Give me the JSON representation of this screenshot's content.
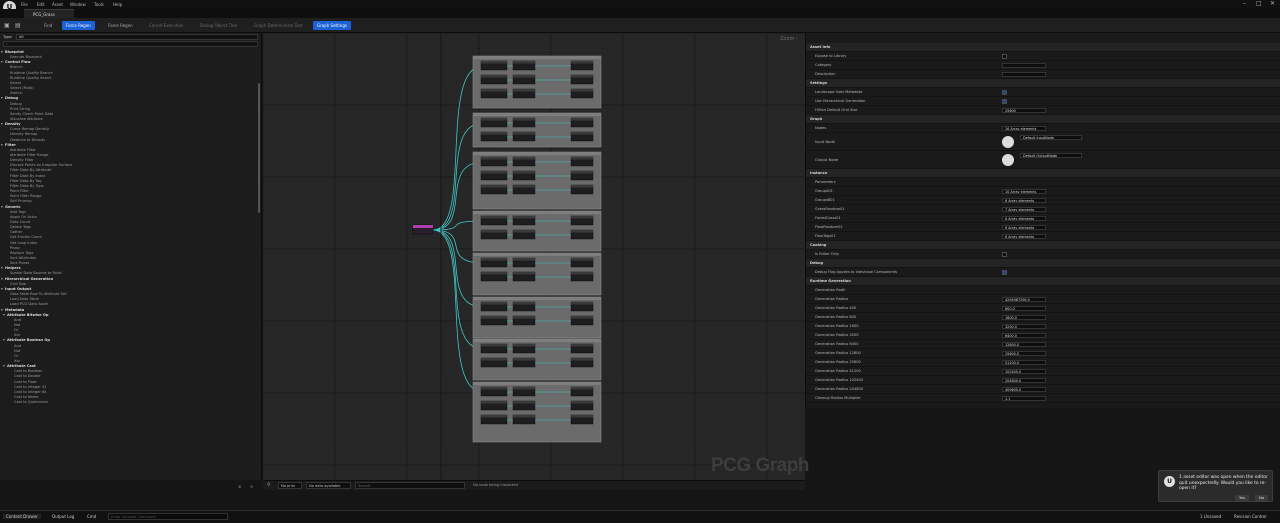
{
  "menu": {
    "file": "File",
    "edit": "Edit",
    "asset": "Asset",
    "window": "Window",
    "tools": "Tools",
    "help": "Help"
  },
  "tab": {
    "title": "PCG_Grass"
  },
  "toolbar": {
    "find": "Find",
    "force_regen": "Force Regen",
    "cancel_execution": "Cancel Execution",
    "debug_object_tree": "Debug Object Tree",
    "graph_determinism_test": "Graph Determinism Test",
    "graph_settings": "Graph Settings"
  },
  "palette": {
    "type_label": "Type",
    "type_value": "All",
    "items": [
      {
        "t": "cat",
        "l": "Blueprint"
      },
      {
        "t": "it",
        "l": "Execute Blueprint"
      },
      {
        "t": "cat",
        "l": "Control Flow"
      },
      {
        "t": "it",
        "l": "Branch"
      },
      {
        "t": "it",
        "l": "Runtime Quality Branch"
      },
      {
        "t": "it",
        "l": "Runtime Quality Select"
      },
      {
        "t": "it",
        "l": "Select"
      },
      {
        "t": "it",
        "l": "Select (Multi)"
      },
      {
        "t": "it",
        "l": "Switch"
      },
      {
        "t": "cat",
        "l": "Debug"
      },
      {
        "t": "it",
        "l": "Debug"
      },
      {
        "t": "it",
        "l": "Print String"
      },
      {
        "t": "it",
        "l": "Sanity Check Point Data"
      },
      {
        "t": "it",
        "l": "Visualize Attribute"
      },
      {
        "t": "cat",
        "l": "Density"
      },
      {
        "t": "it",
        "l": "Curve Remap Density"
      },
      {
        "t": "it",
        "l": "Density Remap"
      },
      {
        "t": "it",
        "l": "Distance to Density"
      },
      {
        "t": "cat",
        "l": "Filter"
      },
      {
        "t": "it",
        "l": "Attribute Filter"
      },
      {
        "t": "it",
        "l": "Attribute Filter Range"
      },
      {
        "t": "it",
        "l": "Density Filter"
      },
      {
        "t": "it",
        "l": "Discard Points on Irregular Surface"
      },
      {
        "t": "it",
        "l": "Filter Data By Attribute"
      },
      {
        "t": "it",
        "l": "Filter Data By Index"
      },
      {
        "t": "it",
        "l": "Filter Data By Tag"
      },
      {
        "t": "it",
        "l": "Filter Data By Type"
      },
      {
        "t": "it",
        "l": "Point Filter"
      },
      {
        "t": "it",
        "l": "Point Filter Range"
      },
      {
        "t": "it",
        "l": "Self Pruning"
      },
      {
        "t": "cat",
        "l": "Generic"
      },
      {
        "t": "it",
        "l": "Add Tags"
      },
      {
        "t": "it",
        "l": "Apply On Actor"
      },
      {
        "t": "it",
        "l": "Data Count"
      },
      {
        "t": "it",
        "l": "Delete Tags"
      },
      {
        "t": "it",
        "l": "Gather"
      },
      {
        "t": "it",
        "l": "Get Entries Count"
      },
      {
        "t": "it",
        "l": "Get Loop Index"
      },
      {
        "t": "it",
        "l": "Proxy"
      },
      {
        "t": "it",
        "l": "Replace Tags"
      },
      {
        "t": "it",
        "l": "Sort Attributes"
      },
      {
        "t": "it",
        "l": "Sort Points"
      },
      {
        "t": "cat",
        "l": "Helpers"
      },
      {
        "t": "it",
        "l": "Spatial Data Bounds to Point"
      },
      {
        "t": "cat",
        "l": "Hierarchical Generation"
      },
      {
        "t": "it",
        "l": "Grid Size"
      },
      {
        "t": "cat",
        "l": "Input Output"
      },
      {
        "t": "it",
        "l": "Data Table Row To Attribute Set"
      },
      {
        "t": "it",
        "l": "Load Data Table"
      },
      {
        "t": "it",
        "l": "Load PCG Data Asset"
      },
      {
        "t": "cat",
        "l": "Metadata"
      },
      {
        "t": "sub",
        "l": "Attribute Bitwise Op"
      },
      {
        "t": "it2",
        "l": "And"
      },
      {
        "t": "it2",
        "l": "Not"
      },
      {
        "t": "it2",
        "l": "Or"
      },
      {
        "t": "it2",
        "l": "Xor"
      },
      {
        "t": "sub",
        "l": "Attribute Boolean Op"
      },
      {
        "t": "it2",
        "l": "And"
      },
      {
        "t": "it2",
        "l": "Not"
      },
      {
        "t": "it2",
        "l": "Or"
      },
      {
        "t": "it2",
        "l": "Xor"
      },
      {
        "t": "sub",
        "l": "Attribute Cast"
      },
      {
        "t": "it2",
        "l": "Cast to Boolean"
      },
      {
        "t": "it2",
        "l": "Cast to Double"
      },
      {
        "t": "it2",
        "l": "Cast to Float"
      },
      {
        "t": "it2",
        "l": "Cast to Integer 32"
      },
      {
        "t": "it2",
        "l": "Cast to Integer 64"
      },
      {
        "t": "it2",
        "l": "Cast to Name"
      },
      {
        "t": "it2",
        "l": "Cast to Quaternion"
      }
    ]
  },
  "graph": {
    "zoom": "Zoom -",
    "watermark": "PCG Graph"
  },
  "bottom": {
    "no_prim": "No prim",
    "no_data": "No data available",
    "search": "Search",
    "status": "No node being inspected"
  },
  "details": {
    "rows": [
      {
        "k": "section",
        "l": "Asset Info"
      },
      {
        "k": "check",
        "l": "Expose to Library",
        "on": false
      },
      {
        "k": "field",
        "l": "Category",
        "v": ""
      },
      {
        "k": "field",
        "l": "Description",
        "v": ""
      },
      {
        "k": "section",
        "l": "Settings"
      },
      {
        "k": "check",
        "l": "Landscape Uses Metadata",
        "on": true
      },
      {
        "k": "check",
        "l": "Use Hierarchical Generation",
        "on": true
      },
      {
        "k": "field",
        "l": "HiGen Default Grid Size",
        "v": "25600"
      },
      {
        "k": "section",
        "l": "Graph"
      },
      {
        "k": "field",
        "l": "Nodes",
        "v": "16 Array elements"
      },
      {
        "k": "tall",
        "l": "Input Node",
        "v": "Default InputNode"
      },
      {
        "k": "tall",
        "l": "Output Node",
        "v": "Default OutputNode"
      },
      {
        "k": "section",
        "l": "Instance"
      },
      {
        "k": "field",
        "l": "Parameters",
        "v": ""
      },
      {
        "k": "field",
        "l": "GroupA01",
        "v": "10 Array elements"
      },
      {
        "k": "field",
        "l": "GroupsB01",
        "v": "6 Array elements"
      },
      {
        "k": "field",
        "l": "GrassRandom01",
        "v": "7 Array elements"
      },
      {
        "k": "field",
        "l": "ForestGrass01",
        "v": "6 Array elements"
      },
      {
        "k": "field",
        "l": "FlowRandom01",
        "v": "6 Array elements"
      },
      {
        "k": "field",
        "l": "FlowTags01",
        "v": "6 Array elements"
      },
      {
        "k": "section",
        "l": "Cooking"
      },
      {
        "k": "check",
        "l": "Is Editor Only",
        "on": false
      },
      {
        "k": "section",
        "l": "Debug"
      },
      {
        "k": "check",
        "l": "Debug Flag Applies to Individual Components",
        "on": true
      },
      {
        "k": "section",
        "l": "Runtime Generation"
      },
      {
        "k": "field",
        "l": "Generation Radii",
        "v": ""
      },
      {
        "k": "field",
        "l": "Generation Radius",
        "v": "4294967296.0"
      },
      {
        "k": "field",
        "l": "Generation Radius 400",
        "v": "800.0"
      },
      {
        "k": "field",
        "l": "Generation Radius 800",
        "v": "1600.0"
      },
      {
        "k": "field",
        "l": "Generation Radius 1600",
        "v": "3200.0"
      },
      {
        "k": "field",
        "l": "Generation Radius 3200",
        "v": "6400.0"
      },
      {
        "k": "field",
        "l": "Generation Radius 6400",
        "v": "12800.0"
      },
      {
        "k": "field",
        "l": "Generation Radius 12800",
        "v": "25600.0"
      },
      {
        "k": "field",
        "l": "Generation Radius 25600",
        "v": "51200.0"
      },
      {
        "k": "field",
        "l": "Generation Radius 51200",
        "v": "102400.0"
      },
      {
        "k": "field",
        "l": "Generation Radius 102400",
        "v": "204800.0"
      },
      {
        "k": "field",
        "l": "Generation Radius 204800",
        "v": "409600.0"
      },
      {
        "k": "field",
        "l": "Cleanup Radius Multiplier",
        "v": "1.1"
      }
    ]
  },
  "toast": {
    "text": "1 asset editor was open when the editor quit unexpectedly. Would you like to re-open it?",
    "yes": "Yes",
    "no": "No"
  },
  "status": {
    "content_drawer": "Content Drawer",
    "output_log": "Output Log",
    "cmd": "Cmd",
    "console_placeholder": "Enter Console Command",
    "unsaved": "1 Unsaved",
    "revision": "Revision Control"
  }
}
